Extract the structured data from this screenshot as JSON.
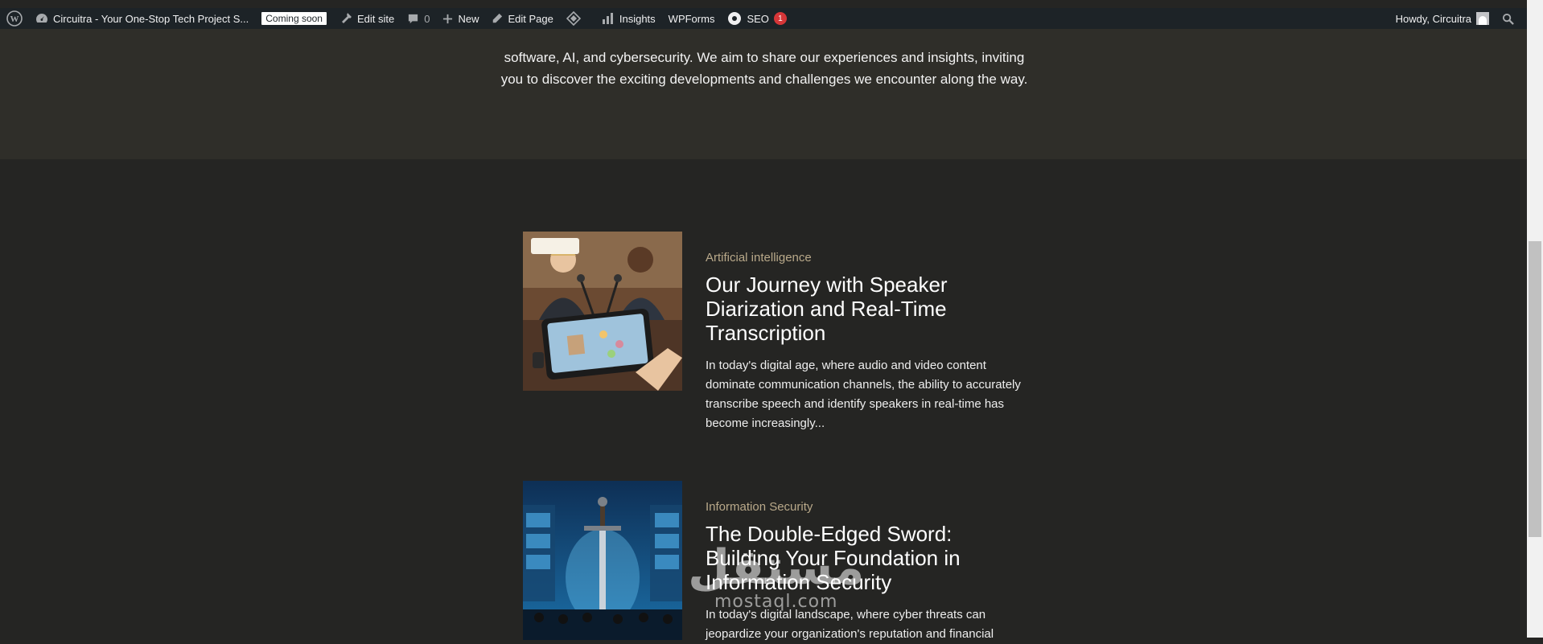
{
  "adminbar": {
    "site_name": "Circuitra - Your One-Stop Tech Project S...",
    "coming_soon": "Coming soon",
    "edit_site": "Edit site",
    "comments_count": "0",
    "new_label": "New",
    "edit_page": "Edit Page",
    "insights": "Insights",
    "wpforms": "WPForms",
    "seo": "SEO",
    "seo_count": "1",
    "howdy": "Howdy, Circuitra"
  },
  "intro_text": "software, AI, and cybersecurity. We aim to share our experiences and insights, inviting you to discover the exciting developments and challenges we encounter along the way.",
  "posts": [
    {
      "category": "Artificial intelligence",
      "title": "Our Journey with Speaker Diarization and Real-Time Transcription",
      "excerpt": "In today's digital age, where audio and video content dominate communication channels, the ability to accurately transcribe speech and identify speakers in real-time has become increasingly..."
    },
    {
      "category": "Information Security",
      "title": "The Double-Edged Sword: Building Your Foundation in Information Security",
      "excerpt": "In today's digital landscape, where cyber threats can jeopardize your organization's reputation and financial"
    }
  ],
  "watermark": {
    "arabic": "مستقل",
    "latin": "mostaql.com"
  },
  "colors": {
    "adminbar": "#1d2327",
    "page_bg": "#252523",
    "band_bg": "#2f2e29",
    "category": "#b9a98a",
    "badge": "#d63638"
  }
}
